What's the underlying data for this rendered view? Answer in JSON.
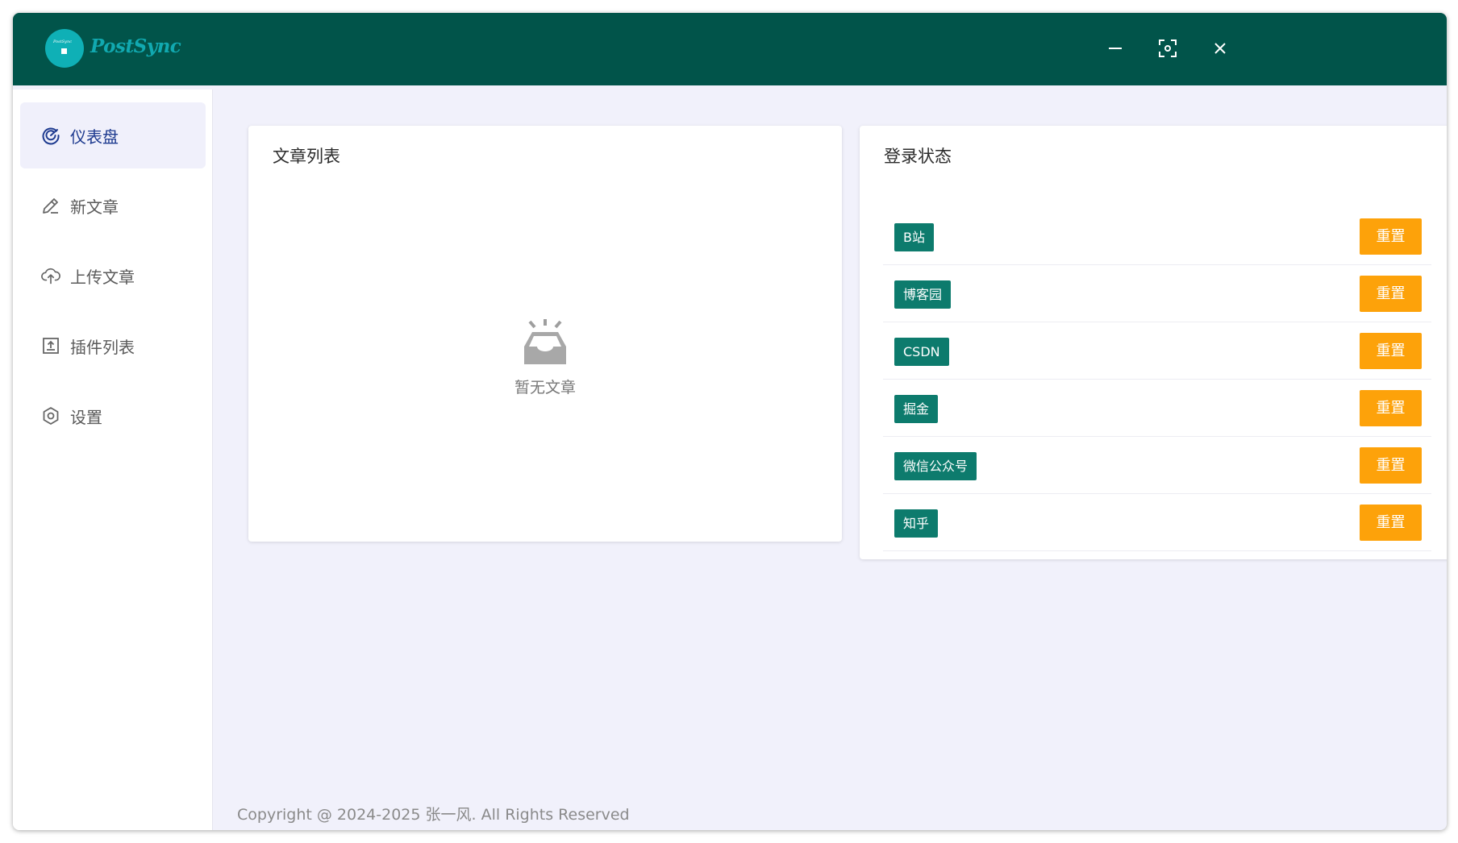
{
  "app": {
    "brand": "PostSync",
    "logo_tiny_text": "PostSync"
  },
  "window_controls": {
    "minimize_icon": "minimize-icon",
    "fullscreen_icon": "fullscreen-icon",
    "close_icon": "close-icon"
  },
  "sidebar": {
    "items": [
      {
        "label": "仪表盘",
        "icon": "dashboard-gauge-icon",
        "active": true
      },
      {
        "label": "新文章",
        "icon": "pencil-edit-icon",
        "active": false
      },
      {
        "label": "上传文章",
        "icon": "cloud-upload-icon",
        "active": false
      },
      {
        "label": "插件列表",
        "icon": "plugin-box-icon",
        "active": false
      },
      {
        "label": "设置",
        "icon": "settings-hexagon-icon",
        "active": false
      }
    ]
  },
  "articles": {
    "title": "文章列表",
    "empty_icon": "empty-inbox-icon",
    "empty_text": "暂无文章"
  },
  "login_status": {
    "title": "登录状态",
    "reset_label": "重置",
    "platforms": [
      {
        "name": "B站"
      },
      {
        "name": "博客园"
      },
      {
        "name": "CSDN"
      },
      {
        "name": "掘金"
      },
      {
        "name": "微信公众号"
      },
      {
        "name": "知乎"
      }
    ]
  },
  "colors": {
    "titlebar": "#01544a",
    "brand": "#11a9b0",
    "tag": "#0d7b6d",
    "reset_button": "#fda20a",
    "active_nav_text": "#1d3a8f"
  },
  "footer": {
    "text": "Copyright @ 2024-2025 张一风. All Rights Reserved"
  }
}
